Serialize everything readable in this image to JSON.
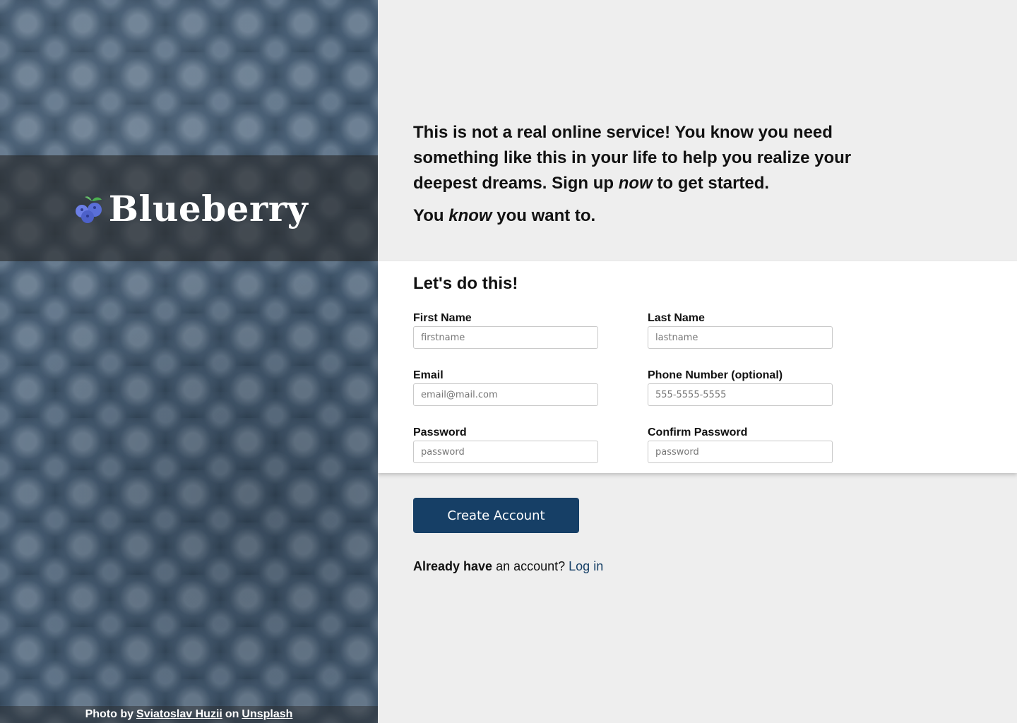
{
  "brand": {
    "name": "Blueberry",
    "icon": "blueberry-icon"
  },
  "credit": {
    "prefix": "Photo by",
    "author": "Sviatoslav Huzii",
    "middle": "on",
    "site": "Unsplash"
  },
  "intro": {
    "line1_a": "This is not a real online service! You know you need something like this in your life to help you realize your deepest dreams. Sign up ",
    "line1_em": "now",
    "line1_b": " to get started.",
    "line2_a": "You ",
    "line2_em": "know",
    "line2_b": " you want to."
  },
  "form": {
    "title": "Let's do this!",
    "first_name": {
      "label": "First Name",
      "placeholder": "firstname"
    },
    "last_name": {
      "label": "Last Name",
      "placeholder": "lastname"
    },
    "email": {
      "label": "Email",
      "placeholder": "email@mail.com"
    },
    "phone": {
      "label": "Phone Number (optional)",
      "placeholder": "555-5555-5555"
    },
    "password": {
      "label": "Password",
      "placeholder": "password"
    },
    "confirm_password": {
      "label": "Confirm Password",
      "placeholder": "password"
    }
  },
  "actions": {
    "create_label": "Create Account",
    "login_prefix_bold": "Already have",
    "login_prefix": " an account? ",
    "login_link": "Log in"
  },
  "colors": {
    "accent": "#163f66",
    "background": "#eeeeee",
    "panel": "#ffffff"
  }
}
